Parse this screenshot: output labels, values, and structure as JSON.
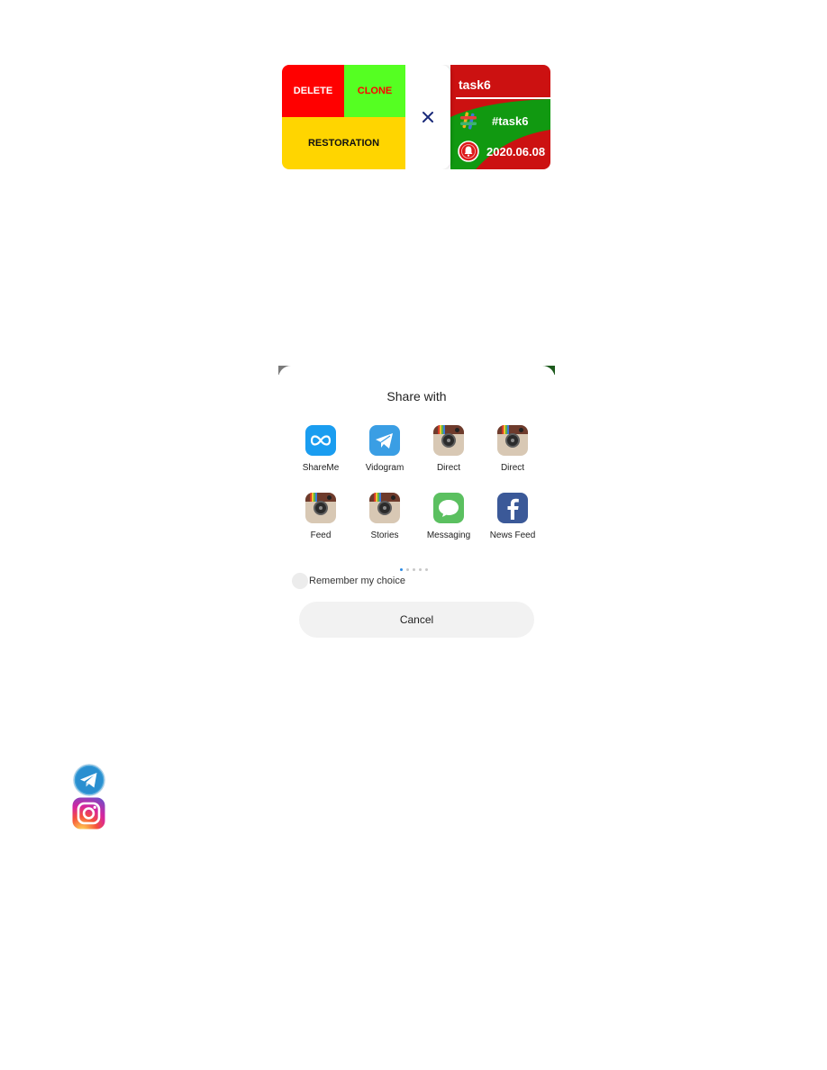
{
  "task_card": {
    "delete_label": "DELETE",
    "clone_label": "CLONE",
    "restoration_label": "RESTORATION",
    "close_symbol": "×",
    "title": "task6",
    "tag": "#task6",
    "date": "2020.06.08",
    "colors": {
      "delete": "#ff0000",
      "clone": "#55ff22",
      "restoration": "#ffd500",
      "card": "#cc1111",
      "wave": "#119911"
    },
    "icons": [
      "close-icon",
      "tag-icon",
      "alarm-icon"
    ]
  },
  "share_sheet": {
    "title": "Share with",
    "apps": [
      {
        "label": "ShareMe",
        "icon": "shareme-icon"
      },
      {
        "label": "Vidogram",
        "icon": "vidogram-icon"
      },
      {
        "label": "Direct",
        "icon": "instagram-classic-icon"
      },
      {
        "label": "Direct",
        "icon": "instagram-classic-icon"
      },
      {
        "label": "Feed",
        "icon": "instagram-classic-icon"
      },
      {
        "label": "Stories",
        "icon": "instagram-classic-icon"
      },
      {
        "label": "Messaging",
        "icon": "messaging-icon"
      },
      {
        "label": "News Feed",
        "icon": "facebook-icon"
      }
    ],
    "page_count": 5,
    "active_page": 1,
    "remember_label": "Remember my choice",
    "remember_checked": false,
    "cancel_label": "Cancel"
  },
  "logos": [
    "telegram-logo",
    "instagram-logo"
  ]
}
